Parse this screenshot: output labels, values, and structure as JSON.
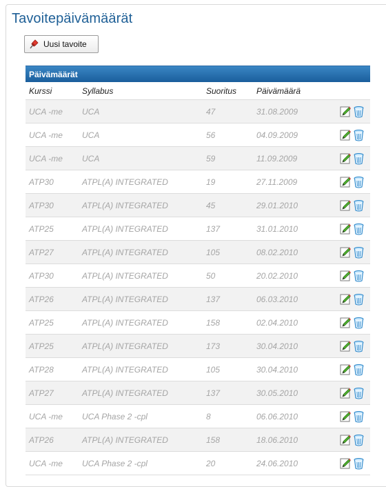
{
  "page": {
    "title": "Tavoitepäivämäärät"
  },
  "toolbar": {
    "new_label": "Uusi tavoite",
    "new_icon": "pushpin-icon"
  },
  "table": {
    "title": "Päivämäärät",
    "headers": {
      "course": "Kurssi",
      "syllabus": "Syllabus",
      "score": "Suoritus",
      "date": "Päivämäärä"
    },
    "edit_icon": "pencil-icon",
    "delete_icon": "trash-icon",
    "rows": [
      {
        "course": "UCA -me",
        "syllabus": "UCA",
        "score": "47",
        "date": "31.08.2009"
      },
      {
        "course": "UCA -me",
        "syllabus": "UCA",
        "score": "56",
        "date": "04.09.2009"
      },
      {
        "course": "UCA -me",
        "syllabus": "UCA",
        "score": "59",
        "date": "11.09.2009"
      },
      {
        "course": "ATP30",
        "syllabus": "ATPL(A) INTEGRATED",
        "score": "19",
        "date": "27.11.2009"
      },
      {
        "course": "ATP30",
        "syllabus": "ATPL(A) INTEGRATED",
        "score": "45",
        "date": "29.01.2010"
      },
      {
        "course": "ATP25",
        "syllabus": "ATPL(A) INTEGRATED",
        "score": "137",
        "date": "31.01.2010"
      },
      {
        "course": "ATP27",
        "syllabus": "ATPL(A) INTEGRATED",
        "score": "105",
        "date": "08.02.2010"
      },
      {
        "course": "ATP30",
        "syllabus": "ATPL(A) INTEGRATED",
        "score": "50",
        "date": "20.02.2010"
      },
      {
        "course": "ATP26",
        "syllabus": "ATPL(A) INTEGRATED",
        "score": "137",
        "date": "06.03.2010"
      },
      {
        "course": "ATP25",
        "syllabus": "ATPL(A) INTEGRATED",
        "score": "158",
        "date": "02.04.2010"
      },
      {
        "course": "ATP25",
        "syllabus": "ATPL(A) INTEGRATED",
        "score": "173",
        "date": "30.04.2010"
      },
      {
        "course": "ATP28",
        "syllabus": "ATPL(A) INTEGRATED",
        "score": "105",
        "date": "30.04.2010"
      },
      {
        "course": "ATP27",
        "syllabus": "ATPL(A) INTEGRATED",
        "score": "137",
        "date": "30.05.2010"
      },
      {
        "course": "UCA -me",
        "syllabus": "UCA Phase 2 -cpl",
        "score": "8",
        "date": "06.06.2010"
      },
      {
        "course": "ATP26",
        "syllabus": "ATPL(A) INTEGRATED",
        "score": "158",
        "date": "18.06.2010"
      },
      {
        "course": "UCA -me",
        "syllabus": "UCA Phase 2 -cpl",
        "score": "20",
        "date": "24.06.2010"
      }
    ]
  },
  "colors": {
    "title": "#1e5f96",
    "header_bar": "#1a5e9c",
    "row_alt": "#f2f2f2",
    "cell_text": "#a5a5a5"
  }
}
